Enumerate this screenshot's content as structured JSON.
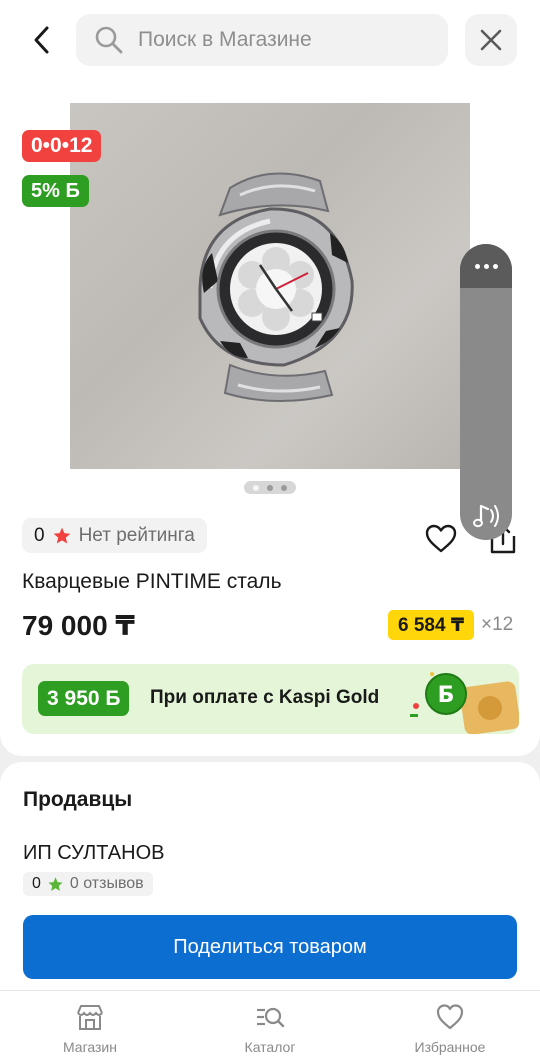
{
  "search": {
    "placeholder": "Поиск в Магазине"
  },
  "badges": {
    "timer": "0•0•12",
    "bonus": "5% Б"
  },
  "gallery": {
    "dots": 3,
    "active_index": 0
  },
  "rating": {
    "value": "0",
    "text": "Нет рейтинга"
  },
  "product": {
    "title": "Кварцевые PINTIME сталь",
    "price": "79 000 ₸",
    "installment_price": "6 584 ₸",
    "installment_months": "×12"
  },
  "kaspi_gold": {
    "bonus_amount": "3 950 Б",
    "text": "При оплате с Kaspi Gold"
  },
  "sellers": {
    "title": "Продавцы",
    "items": [
      {
        "name": "ИП СУЛТАНОВ",
        "rating": "0",
        "reviews": "0 отзывов"
      }
    ]
  },
  "share_button": {
    "label": "Поделиться товаром"
  },
  "nav": [
    {
      "label": "Магазин",
      "icon": "store-icon"
    },
    {
      "label": "Каталог",
      "icon": "catalog-search-icon"
    },
    {
      "label": "Избранное",
      "icon": "heart-icon"
    }
  ],
  "colors": {
    "accent_blue": "#0c6ed1",
    "timer_red": "#f2423f",
    "bonus_green": "#2e9e22",
    "installment_yellow": "#ffd60a",
    "gold_banner_bg": "#e5f6d8"
  }
}
